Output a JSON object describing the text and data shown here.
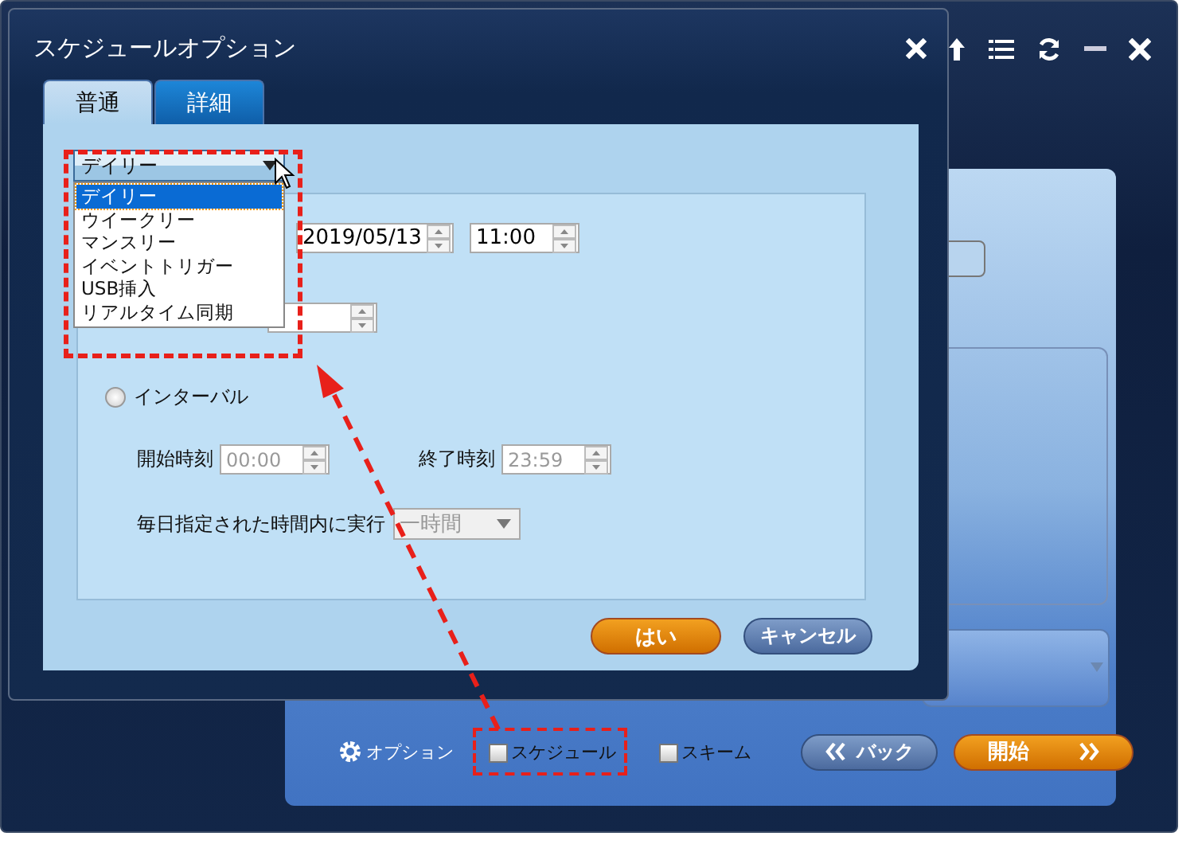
{
  "dialog": {
    "title": "スケジュールオプション",
    "tabs": [
      {
        "label": "普通",
        "selected": true
      },
      {
        "label": "詳細",
        "selected": false
      }
    ],
    "frequency": {
      "value": "デイリー",
      "expanded": true,
      "highlighted": true,
      "options": [
        {
          "label": "デイリー",
          "selected": true
        },
        {
          "label": "ウイークリー",
          "selected": false
        },
        {
          "label": "マンスリー",
          "selected": false
        },
        {
          "label": "イベントトリガー",
          "selected": false
        },
        {
          "label": "USB挿入",
          "selected": false
        },
        {
          "label": "リアルタイム同期",
          "selected": false
        }
      ]
    },
    "start_date": "2019/05/13",
    "start_time": "11:00",
    "interval": {
      "label": "インターバル",
      "selected": false,
      "enabled": false,
      "start_label": "開始時刻",
      "start_value": "00:00",
      "end_label": "終了時刻",
      "end_value": "23:59",
      "run_label": "毎日指定された時間内に実行",
      "run_value": "一時間"
    },
    "buttons": [
      {
        "label": "はい",
        "kind": "primary"
      },
      {
        "label": "キャンセル",
        "kind": "secondary"
      }
    ]
  },
  "footer": {
    "option_label": "オプション",
    "checkboxes": [
      {
        "label": "スケジュール",
        "checked": false,
        "highlighted": true
      },
      {
        "label": "スキーム",
        "checked": false,
        "highlighted": false
      }
    ],
    "buttons": [
      {
        "label": "バック",
        "kind": "back"
      },
      {
        "label": "開始",
        "kind": "next"
      }
    ]
  }
}
